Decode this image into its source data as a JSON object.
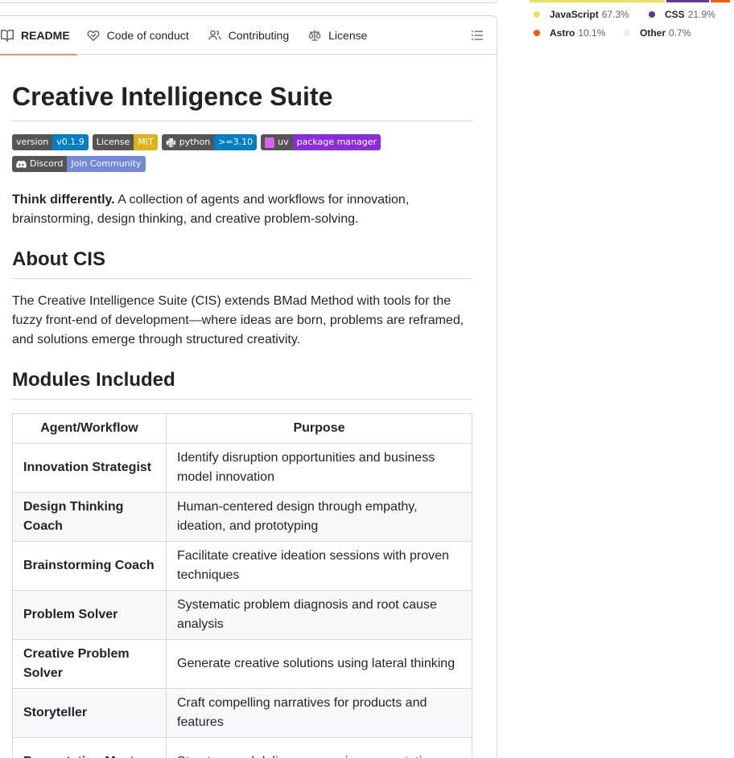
{
  "tabs": [
    {
      "label": "README",
      "icon": "book-icon"
    },
    {
      "label": "Code of conduct",
      "icon": "code-of-conduct-icon"
    },
    {
      "label": "Contributing",
      "icon": "people-icon"
    },
    {
      "label": "License",
      "icon": "law-icon"
    }
  ],
  "readme": {
    "title": "Creative Intelligence Suite",
    "badges": [
      {
        "label": "version",
        "value": "v0.1.9",
        "color": "#007ec6"
      },
      {
        "label": "License",
        "value": "MIT",
        "color": "#dfb317"
      },
      {
        "label": "python",
        "value": ">=3.10",
        "color": "#007ec6",
        "icon": "python-icon"
      },
      {
        "label": "uv",
        "value": "package manager",
        "color": "#8a2be2",
        "icon": "uv-icon"
      },
      {
        "label": "Discord",
        "value": "Join Community",
        "color": "#7289da",
        "icon": "discord-icon"
      }
    ],
    "intro_bold": "Think differently.",
    "intro_rest": " A collection of agents and workflows for innovation, brainstorming, design thinking, and creative problem-solving.",
    "about_heading": "About CIS",
    "about_text": "The Creative Intelligence Suite (CIS) extends BMad Method with tools for the fuzzy front-end of development—where ideas are born, problems are reframed, and solutions emerge through structured creativity.",
    "modules_heading": "Modules Included",
    "table": {
      "headers": [
        "Agent/Workflow",
        "Purpose"
      ],
      "rows": [
        {
          "agent": "Innovation Strategist",
          "purpose": "Identify disruption opportunities and business model innovation"
        },
        {
          "agent": "Design Thinking Coach",
          "purpose": "Human-centered design through empathy, ideation, and prototyping"
        },
        {
          "agent": "Brainstorming Coach",
          "purpose": "Facilitate creative ideation sessions with proven techniques"
        },
        {
          "agent": "Problem Solver",
          "purpose": "Systematic problem diagnosis and root cause analysis"
        },
        {
          "agent": "Creative Problem Solver",
          "purpose": "Generate creative solutions using lateral thinking"
        },
        {
          "agent": "Storyteller",
          "purpose": "Craft compelling narratives for products and features"
        },
        {
          "agent": "Presentation Master",
          "purpose": "Structure and deliver persuasive presentations"
        }
      ]
    }
  },
  "languages": [
    {
      "name": "JavaScript",
      "percent": "67.3%",
      "value": 67.3,
      "color": "#f1e05a"
    },
    {
      "name": "CSS",
      "percent": "21.9%",
      "value": 21.9,
      "color": "#663399"
    },
    {
      "name": "Astro",
      "percent": "10.1%",
      "value": 10.1,
      "color": "#ff5a03"
    },
    {
      "name": "Other",
      "percent": "0.7%",
      "value": 0.7,
      "color": "#ededed"
    }
  ]
}
